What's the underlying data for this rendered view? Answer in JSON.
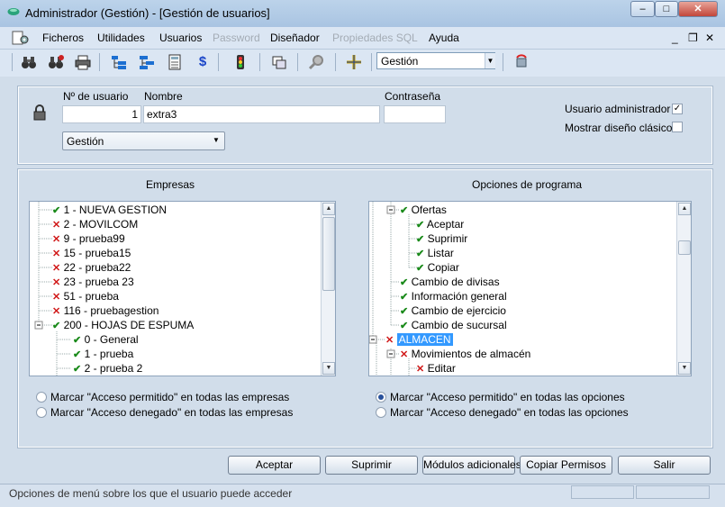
{
  "window": {
    "title": "Administrador (Gestión) - [Gestión de usuarios]",
    "minimize_label": "–",
    "maximize_label": "□",
    "close_label": "✕"
  },
  "menu": {
    "items": [
      {
        "label": "Ficheros",
        "enabled": true
      },
      {
        "label": "Utilidades",
        "enabled": true
      },
      {
        "label": "Usuarios",
        "enabled": true
      },
      {
        "label": "Password",
        "enabled": false
      },
      {
        "label": "Diseñador",
        "enabled": true
      },
      {
        "label": "Propiedades SQL",
        "enabled": false
      },
      {
        "label": "Ayuda",
        "enabled": true
      }
    ],
    "mdi_min": "_",
    "mdi_restore": "❐",
    "mdi_close": "✕"
  },
  "toolbar": {
    "icons": [
      "binoculars-icon",
      "find-next-icon",
      "print-icon",
      "tree-view-icon",
      "tree-view-alt-icon",
      "calculator-icon",
      "currency-icon",
      "traffic-light-icon",
      "window-icon",
      "search-icon",
      "crosshair-icon",
      "refresh-icon"
    ],
    "combo_value": "Gestión"
  },
  "user": {
    "id_label": "Nº de usuario",
    "id_value": "1",
    "name_label": "Nombre",
    "name_value": "extra3",
    "password_label": "Contraseña",
    "password_value": "",
    "profile_value": "Gestión",
    "admin_label": "Usuario administrador",
    "admin_checked": true,
    "classic_label": "Mostrar diseño clásico",
    "classic_checked": false
  },
  "companies": {
    "header": "Empresas",
    "nodes": [
      {
        "label": "1 - NUEVA GESTION",
        "state": "ok"
      },
      {
        "label": "2 - MOVILCOM",
        "state": "no"
      },
      {
        "label": "9 - prueba99",
        "state": "no"
      },
      {
        "label": "15 - prueba15",
        "state": "no"
      },
      {
        "label": "22 - prueba22",
        "state": "no"
      },
      {
        "label": "23 - prueba 23",
        "state": "no"
      },
      {
        "label": "51 - prueba",
        "state": "no"
      },
      {
        "label": "116 - pruebagestion",
        "state": "no"
      },
      {
        "label": "200 - HOJAS DE ESPUMA",
        "state": "ok"
      },
      {
        "label": "0 - General",
        "state": "ok"
      },
      {
        "label": "1 - prueba",
        "state": "ok"
      },
      {
        "label": "2 - prueba 2",
        "state": "ok"
      }
    ],
    "radio_allow": "Marcar \"Acceso permitido\" en todas las empresas",
    "radio_deny": "Marcar \"Acceso denegado\" en todas las empresas",
    "selected_radio": "none"
  },
  "options": {
    "header": "Opciones de programa",
    "nodes": [
      {
        "label": "Ofertas",
        "state": "ok"
      },
      {
        "label": "Aceptar",
        "state": "ok"
      },
      {
        "label": "Suprimir",
        "state": "ok"
      },
      {
        "label": "Listar",
        "state": "ok"
      },
      {
        "label": "Copiar",
        "state": "ok"
      },
      {
        "label": "Cambio de divisas",
        "state": "ok"
      },
      {
        "label": "Información general",
        "state": "ok"
      },
      {
        "label": "Cambio de ejercicio",
        "state": "ok"
      },
      {
        "label": "Cambio de sucursal",
        "state": "ok"
      },
      {
        "label": "ALMACEN",
        "state": "no"
      },
      {
        "label": "Movimientos de almacén",
        "state": "no"
      },
      {
        "label": "Editar",
        "state": "no"
      }
    ],
    "radio_allow": "Marcar \"Acceso permitido\" en todas las opciones",
    "radio_deny": "Marcar \"Acceso denegado\" en todas las opciones",
    "selected_radio": "allow"
  },
  "buttons": {
    "accept": "Aceptar",
    "delete": "Suprimir",
    "modules": "Módulos adicionales",
    "copy": "Copiar Permisos",
    "exit": "Salir"
  },
  "status": {
    "text": "Opciones de menú sobre los que el usuario puede acceder"
  }
}
